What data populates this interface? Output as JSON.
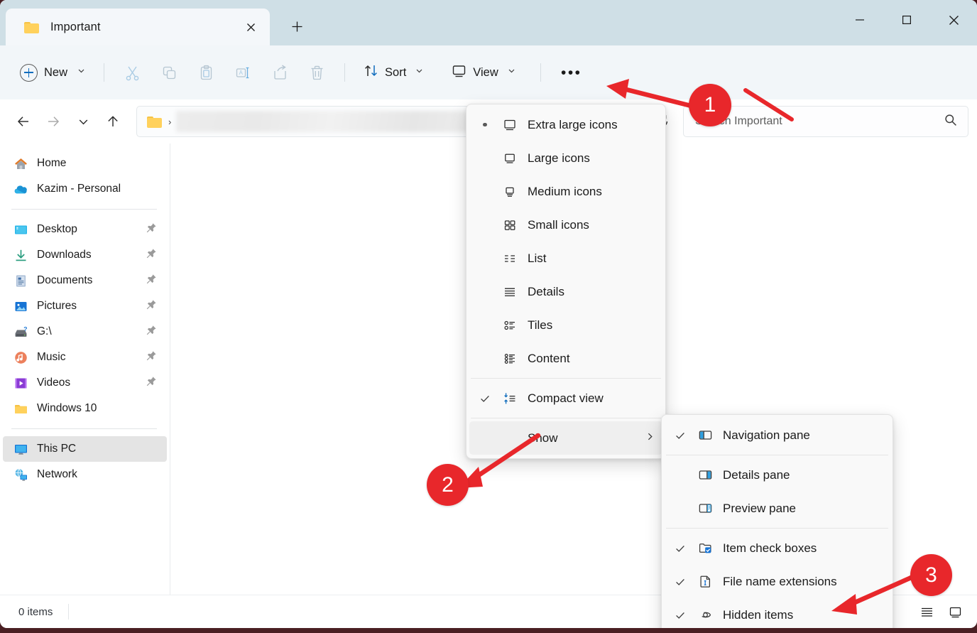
{
  "window": {
    "tab_title": "Important",
    "tab_folder_icon": "folder-icon",
    "close_icon": "close-icon",
    "new_tab_icon": "plus-icon",
    "minimize_icon": "minimize-icon",
    "maximize_icon": "maximize-icon",
    "window_close_icon": "close-icon"
  },
  "toolbar": {
    "new_label": "New",
    "new_icon": "plus-circle-icon",
    "new_chevron": "chevron-down-icon",
    "cut_icon": "scissors-icon",
    "copy_icon": "copy-icon",
    "paste_icon": "paste-icon",
    "rename_icon": "rename-icon",
    "share_icon": "share-icon",
    "delete_icon": "trash-icon",
    "sort_label": "Sort",
    "sort_icon": "sort-arrows-icon",
    "sort_chevron": "chevron-down-icon",
    "view_label": "View",
    "view_icon": "monitor-icon",
    "view_chevron": "chevron-down-icon",
    "more_label": "•••",
    "more_icon": "ellipsis-icon"
  },
  "addressbar": {
    "back_icon": "arrow-left-icon",
    "forward_icon": "arrow-right-icon",
    "recent_icon": "chevron-down-icon",
    "up_icon": "arrow-up-icon",
    "folder_icon": "folder-icon",
    "breadcrumb_separator": "›",
    "path_redacted": true,
    "refresh_icon": "refresh-icon"
  },
  "search": {
    "placeholder": "Search Important",
    "icon": "search-icon"
  },
  "sidebar": {
    "items": [
      {
        "label": "Home",
        "icon": "home-icon",
        "pinned": false,
        "selected": false
      },
      {
        "label": "Kazim - Personal",
        "icon": "onedrive-icon",
        "pinned": false,
        "selected": false
      },
      {
        "label": "Desktop",
        "icon": "desktop-icon",
        "pinned": true,
        "selected": false
      },
      {
        "label": "Downloads",
        "icon": "download-icon",
        "pinned": true,
        "selected": false
      },
      {
        "label": "Documents",
        "icon": "documents-icon",
        "pinned": true,
        "selected": false
      },
      {
        "label": "Pictures",
        "icon": "pictures-icon",
        "pinned": true,
        "selected": false
      },
      {
        "label": "G:\\",
        "icon": "drive-icon",
        "pinned": true,
        "selected": false
      },
      {
        "label": "Music",
        "icon": "music-icon",
        "pinned": true,
        "selected": false
      },
      {
        "label": "Videos",
        "icon": "videos-icon",
        "pinned": true,
        "selected": false
      },
      {
        "label": "Windows 10",
        "icon": "folder-icon",
        "pinned": false,
        "selected": false
      },
      {
        "label": "This PC",
        "icon": "this-pc-icon",
        "pinned": false,
        "selected": true
      },
      {
        "label": "Network",
        "icon": "network-icon",
        "pinned": false,
        "selected": false
      }
    ]
  },
  "view_menu": {
    "items": [
      {
        "label": "Extra large icons",
        "icon": "extra-large-icons-icon",
        "radio_selected": true,
        "checked": false
      },
      {
        "label": "Large icons",
        "icon": "large-icons-icon",
        "radio_selected": false,
        "checked": false
      },
      {
        "label": "Medium icons",
        "icon": "medium-icons-icon",
        "radio_selected": false,
        "checked": false
      },
      {
        "label": "Small icons",
        "icon": "small-icons-icon",
        "radio_selected": false,
        "checked": false
      },
      {
        "label": "List",
        "icon": "list-icon",
        "radio_selected": false,
        "checked": false
      },
      {
        "label": "Details",
        "icon": "details-icon",
        "radio_selected": false,
        "checked": false
      },
      {
        "label": "Tiles",
        "icon": "tiles-icon",
        "radio_selected": false,
        "checked": false
      },
      {
        "label": "Content",
        "icon": "content-icon",
        "radio_selected": false,
        "checked": false
      },
      {
        "label": "Compact view",
        "icon": "compact-view-icon",
        "radio_selected": false,
        "checked": true
      },
      {
        "label": "Show",
        "icon": null,
        "radio_selected": false,
        "checked": false,
        "has_submenu": true,
        "highlighted": true
      }
    ]
  },
  "show_menu": {
    "items": [
      {
        "label": "Navigation pane",
        "icon": "navigation-pane-icon",
        "checked": true
      },
      {
        "label": "Details pane",
        "icon": "details-pane-icon",
        "checked": false
      },
      {
        "label": "Preview pane",
        "icon": "preview-pane-icon",
        "checked": false
      },
      {
        "label": "Item check boxes",
        "icon": "item-check-boxes-icon",
        "checked": true
      },
      {
        "label": "File name extensions",
        "icon": "file-name-extensions-icon",
        "checked": true
      },
      {
        "label": "Hidden items",
        "icon": "hidden-items-icon",
        "checked": true
      }
    ]
  },
  "statusbar": {
    "items_count": "0 items",
    "list_view_icon": "details-view-icon",
    "tile_view_icon": "large-icons-view-icon"
  },
  "annotations": {
    "markers": [
      {
        "number": "1",
        "points_to": "view-button"
      },
      {
        "number": "2",
        "points_to": "show-menu-item"
      },
      {
        "number": "3",
        "points_to": "hidden-items-menu-item"
      }
    ],
    "color": "#e8272b"
  },
  "colors": {
    "accent": "#0f6cbd",
    "titlebar_bg": "#cfdfe6",
    "toolbar_bg": "#f2f6f9",
    "menu_bg": "#f9f9f9",
    "selected_nav_bg": "#e4e4e4",
    "annotation_red": "#e8272b"
  }
}
